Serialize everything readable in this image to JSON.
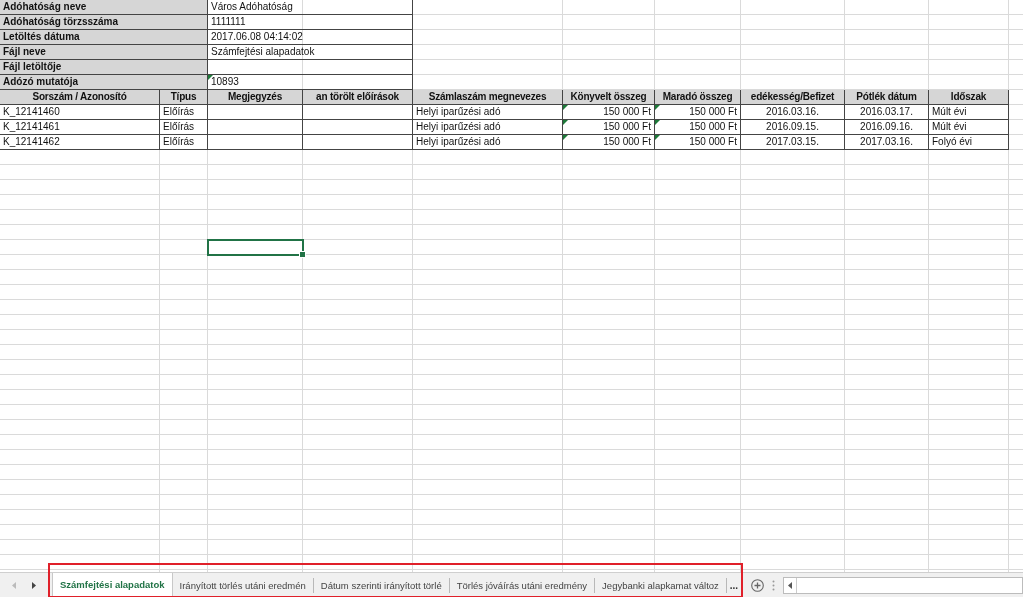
{
  "info_rows": [
    {
      "label": "Adóhatóság neve",
      "value": " Város Adóhatóság",
      "warning": false
    },
    {
      "label": "Adóhatóság törzsszáma",
      "value": "1111111",
      "warning": false
    },
    {
      "label": "Letöltés dátuma",
      "value": "2017.06.08 04:14:02",
      "warning": false
    },
    {
      "label": "Fájl neve",
      "value": "Számfejtési alapadatok",
      "warning": false
    },
    {
      "label": "Fájl letöltője",
      "warning": false
    },
    {
      "label": "Adózó mutatója",
      "value": "10893",
      "warning": true
    }
  ],
  "table": {
    "columns": [
      "Sorszám / Azonosító",
      "Típus",
      "Megjegyzés",
      "an törölt előírások",
      "Számlaszám megnevezes",
      "Könyvelt összeg",
      "Maradó összeg",
      "edékesség/Befizet",
      "Pótlék dátum",
      "Időszak"
    ],
    "rows": [
      {
        "cells": [
          {
            "text": "K_12141460",
            "warning": false
          },
          {
            "text": "Előírás",
            "warning": false
          },
          {
            "warning": false
          },
          {
            "warning": false
          },
          {
            "text": "Helyi iparűzési adó",
            "warning": false
          },
          {
            "text": "150 000 Ft",
            "warning": true
          },
          {
            "text": "150 000 Ft",
            "warning": true
          },
          {
            "text": "2016.03.16.",
            "warning": false
          },
          {
            "text": "2016.03.17.",
            "warning": false
          },
          {
            "text": "Múlt évi",
            "warning": false
          }
        ]
      },
      {
        "cells": [
          {
            "text": "K_12141461",
            "warning": false
          },
          {
            "text": "Előírás",
            "warning": false
          },
          {
            "warning": false
          },
          {
            "warning": false
          },
          {
            "text": "Helyi iparűzési adó",
            "warning": false
          },
          {
            "text": "150 000 Ft",
            "warning": true
          },
          {
            "text": "150 000 Ft",
            "warning": true
          },
          {
            "text": "2016.09.15.",
            "warning": false
          },
          {
            "text": "2016.09.16.",
            "warning": false
          },
          {
            "text": "Múlt évi",
            "warning": false
          }
        ]
      },
      {
        "cells": [
          {
            "text": "K_12141462",
            "warning": false
          },
          {
            "text": "Előírás",
            "warning": false
          },
          {
            "warning": false
          },
          {
            "warning": false
          },
          {
            "text": "Helyi iparűzési adó",
            "warning": false
          },
          {
            "text": "150 000 Ft",
            "warning": true
          },
          {
            "text": "150 000 Ft",
            "warning": true
          },
          {
            "text": "2017.03.15.",
            "warning": false
          },
          {
            "text": "2017.03.16.",
            "warning": false
          },
          {
            "text": "Folyó évi",
            "warning": false
          }
        ]
      }
    ]
  },
  "active_cell": {
    "visible": true
  },
  "sheet_tabs": [
    {
      "label": "Számfejtési alapadatok",
      "selected": true
    },
    {
      "label": "Irányított törlés utáni eredmén",
      "selected": false
    },
    {
      "label": "Dátum szerinti irányított törlé",
      "selected": false
    },
    {
      "label": "Törlés jóváírás utáni eredmény",
      "selected": false
    },
    {
      "label": "Jegybanki alapkamat változ",
      "selected": false
    }
  ],
  "tab_overflow": "..."
}
